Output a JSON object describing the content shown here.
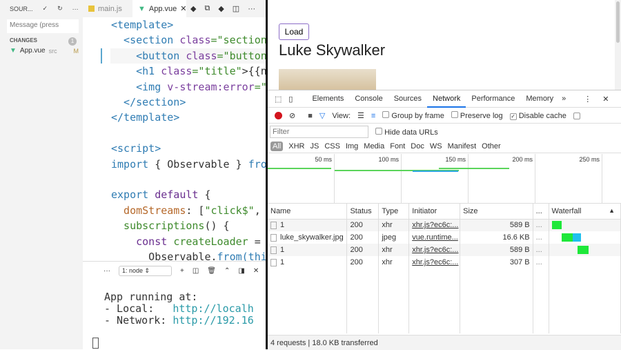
{
  "sidebar": {
    "title": "SOUR...",
    "message_placeholder": "Message (press",
    "changes_label": "CHANGES",
    "changes_count": "1",
    "file": {
      "name": "App.vue",
      "dir": "src",
      "status": "M"
    }
  },
  "editor": {
    "tabs": [
      {
        "label": "main.js"
      },
      {
        "label": "App.vue",
        "active": true
      }
    ],
    "lines": [
      [
        {
          "t": "<template>",
          "c": "#2f7cb3"
        }
      ],
      [
        {
          "t": "  <section ",
          "c": "#2f7cb3"
        },
        {
          "t": "class",
          "c": "#7b3f9e"
        },
        {
          "t": "=\"section\"",
          "c": "#3e8a2c"
        }
      ],
      [
        {
          "t": "    <button ",
          "c": "#2f7cb3"
        },
        {
          "t": "class",
          "c": "#7b3f9e"
        },
        {
          "t": "=\"button\"",
          "c": "#3e8a2c"
        }
      ],
      [
        {
          "t": "    <h1 ",
          "c": "#2f7cb3"
        },
        {
          "t": "class",
          "c": "#7b3f9e"
        },
        {
          "t": "=\"title\"",
          "c": "#3e8a2c"
        },
        {
          "t": ">{{na",
          "c": "#333"
        }
      ],
      [
        {
          "t": "    <img ",
          "c": "#2f7cb3"
        },
        {
          "t": "v-stream:error",
          "c": "#7b3f9e"
        },
        {
          "t": "=\"",
          "c": "#3e8a2c"
        }
      ],
      [
        {
          "t": "  </section>",
          "c": "#2f7cb3"
        }
      ],
      [
        {
          "t": "</template>",
          "c": "#2f7cb3"
        }
      ],
      [],
      [
        {
          "t": "<script>",
          "c": "#2f7cb3"
        }
      ],
      [
        {
          "t": "import",
          "c": "#2f7cb3"
        },
        {
          "t": " { Observable } ",
          "c": "#333"
        },
        {
          "t": "from",
          "c": "#2f7cb3"
        }
      ],
      [],
      [
        {
          "t": "export",
          "c": "#2f7cb3"
        },
        {
          "t": " default",
          "c": "#6a2f8f"
        },
        {
          "t": " {",
          "c": "#333"
        }
      ],
      [
        {
          "t": "  domStreams",
          "c": "#b5682a"
        },
        {
          "t": ": [",
          "c": "#333"
        },
        {
          "t": "\"click$\"",
          "c": "#3e8a2c"
        },
        {
          "t": ",",
          "c": "#333"
        }
      ],
      [
        {
          "t": "  subscriptions",
          "c": "#3e8a2c"
        },
        {
          "t": "() {",
          "c": "#333"
        }
      ],
      [
        {
          "t": "    const ",
          "c": "#6a2f8f"
        },
        {
          "t": "createLoader",
          "c": "#3e8a2c"
        },
        {
          "t": " = ",
          "c": "#333"
        }
      ],
      [
        {
          "t": "      Observable.",
          "c": "#333"
        },
        {
          "t": "from",
          "c": "#2f7cb3"
        },
        {
          "t": "(this",
          "c": "#2f7cb3"
        }
      ]
    ]
  },
  "terminal": {
    "select": "1: node",
    "lines": [
      [
        {
          "t": "App running at:",
          "c": "#333"
        }
      ],
      [
        {
          "t": "- Local:   ",
          "c": "#333"
        },
        {
          "t": "http://localh",
          "c": "#2a9aa8"
        }
      ],
      [
        {
          "t": "- Network: ",
          "c": "#333"
        },
        {
          "t": "http://192.16",
          "c": "#2a9aa8"
        }
      ]
    ]
  },
  "page": {
    "button": "Load",
    "title": "Luke Skywalker"
  },
  "devtools": {
    "tabs": [
      "Elements",
      "Console",
      "Sources",
      "Network",
      "Performance",
      "Memory"
    ],
    "active_tab": "Network",
    "toolbar": {
      "view": "View:",
      "group_by_frame": "Group by frame",
      "preserve_log": "Preserve log",
      "disable_cache": "Disable cache",
      "disable_cache_checked": true
    },
    "filter_placeholder": "Filter",
    "hide_data_urls": "Hide data URLs",
    "types": [
      "All",
      "XHR",
      "JS",
      "CSS",
      "Img",
      "Media",
      "Font",
      "Doc",
      "WS",
      "Manifest",
      "Other"
    ],
    "timeline_ticks": [
      "50 ms",
      "100 ms",
      "150 ms",
      "200 ms",
      "250 ms"
    ],
    "columns": [
      "Name",
      "Status",
      "Type",
      "Initiator",
      "Size",
      "...",
      "Waterfall"
    ],
    "rows": [
      {
        "name": "1",
        "status": "200",
        "type": "xhr",
        "initiator": "xhr.js?ec6c:...",
        "size": "589 B",
        "more": "...",
        "wf_start": 0,
        "wf_wait": 14,
        "wf_recv": 0
      },
      {
        "name": "luke_skywalker.jpg",
        "status": "200",
        "type": "jpeg",
        "initiator": "vue.runtime...",
        "size": "16.6 KB",
        "more": "...",
        "wf_start": 14,
        "wf_wait": 16,
        "wf_recv": 12
      },
      {
        "name": "1",
        "status": "200",
        "type": "xhr",
        "initiator": "xhr.js?ec6c:...",
        "size": "589 B",
        "more": "...",
        "wf_start": 37,
        "wf_wait": 16,
        "wf_recv": 0
      },
      {
        "name": "1",
        "status": "200",
        "type": "xhr",
        "initiator": "xhr.js?ec6c:...",
        "size": "307 B",
        "more": "...",
        "wf_start": 0,
        "wf_wait": 0,
        "wf_recv": 0
      }
    ],
    "footer": "4 requests | 18.0 KB transferred"
  }
}
